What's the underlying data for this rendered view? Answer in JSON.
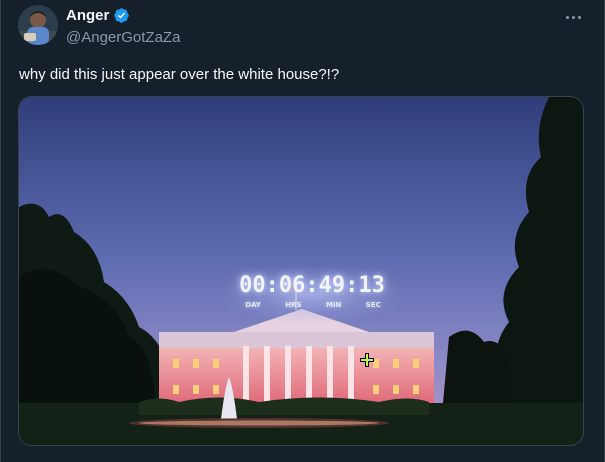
{
  "tweet": {
    "display_name": "Anger",
    "handle": "@AngerGotZaZa",
    "verified": true,
    "text": "why did this just appear over the white house?!?"
  },
  "media": {
    "countdown": {
      "time": "00:06:49:13",
      "labels": [
        "DAY",
        "HRS",
        "MIN",
        "SEC"
      ]
    }
  },
  "colors": {
    "background": "#15202b",
    "text": "#f7f9f9",
    "secondary_text": "#8b98a5",
    "verified": "#1d9bf0",
    "border": "#38444d"
  }
}
